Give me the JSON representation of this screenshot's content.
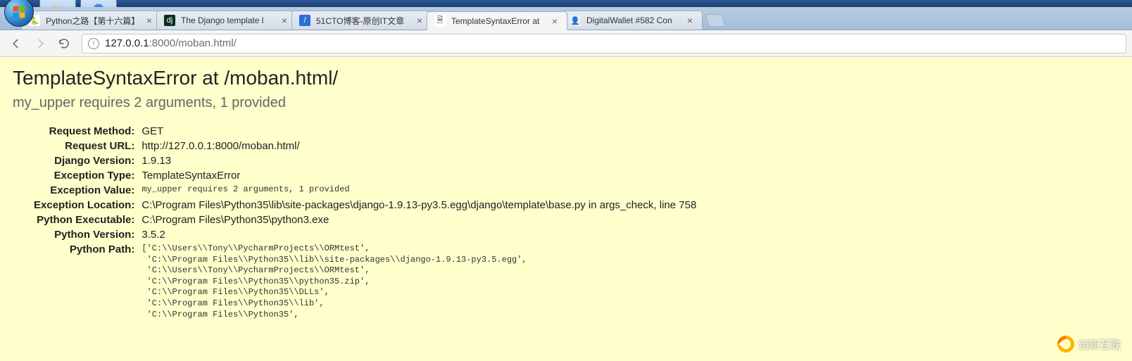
{
  "tabs": [
    {
      "title": "Python之路【第十六篇】",
      "favicon_bg": "#fff",
      "favicon_txt": "🐍",
      "active": false
    },
    {
      "title": "The Django template l",
      "favicon_bg": "#092e20",
      "favicon_txt": "dj",
      "favicon_color": "#fff",
      "active": false
    },
    {
      "title": "51CTO博客-原创IT文章",
      "favicon_bg": "#2b6fd6",
      "favicon_txt": "/",
      "favicon_color": "#fff",
      "active": false
    },
    {
      "title": "TemplateSyntaxError at",
      "favicon_bg": "#fff",
      "favicon_txt": "🗎",
      "active": true
    },
    {
      "title": "DigitalWallet #582 Con",
      "favicon_bg": "#eee",
      "favicon_txt": "👤",
      "active": false
    }
  ],
  "omnibox": {
    "host": "127.0.0.1",
    "port": ":8000",
    "path": "/moban.html/"
  },
  "error": {
    "heading": "TemplateSyntaxError at /moban.html/",
    "subheading": "my_upper requires 2 arguments, 1 provided",
    "rows": {
      "request_method": {
        "label": "Request Method:",
        "value": "GET"
      },
      "request_url": {
        "label": "Request URL:",
        "value": "http://127.0.0.1:8000/moban.html/"
      },
      "django_version": {
        "label": "Django Version:",
        "value": "1.9.13"
      },
      "exception_type": {
        "label": "Exception Type:",
        "value": "TemplateSyntaxError"
      },
      "exception_value": {
        "label": "Exception Value:",
        "value": "my_upper requires 2 arguments, 1 provided",
        "code": true
      },
      "exception_location": {
        "label": "Exception Location:",
        "value": "C:\\Program Files\\Python35\\lib\\site-packages\\django-1.9.13-py3.5.egg\\django\\template\\base.py in args_check, line 758"
      },
      "python_executable": {
        "label": "Python Executable:",
        "value": "C:\\Program Files\\Python35\\python3.exe"
      },
      "python_version": {
        "label": "Python Version:",
        "value": "3.5.2"
      },
      "python_path": {
        "label": "Python Path:",
        "value": "['C:\\\\Users\\\\Tony\\\\PycharmProjects\\\\ORMtest',\n 'C:\\\\Program Files\\\\Python35\\\\lib\\\\site-packages\\\\django-1.9.13-py3.5.egg',\n 'C:\\\\Users\\\\Tony\\\\PycharmProjects\\\\ORMtest',\n 'C:\\\\Program Files\\\\Python35\\\\python35.zip',\n 'C:\\\\Program Files\\\\Python35\\\\DLLs',\n 'C:\\\\Program Files\\\\Python35\\\\lib',\n 'C:\\\\Program Files\\\\Python35',",
        "code": true
      }
    }
  },
  "watermark": "创新互联"
}
